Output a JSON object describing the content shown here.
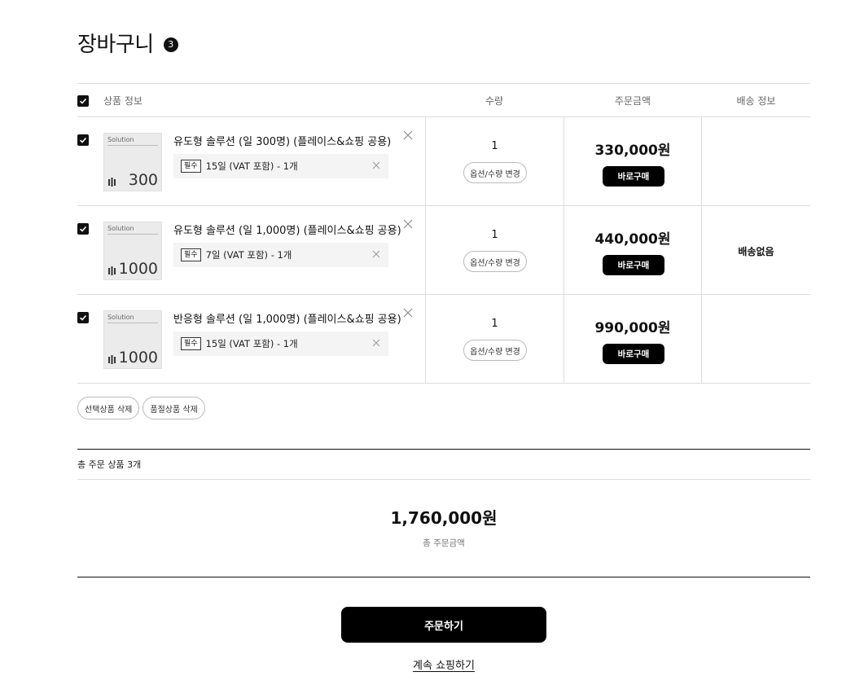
{
  "page": {
    "title": "장바구니",
    "count": "3"
  },
  "table": {
    "headers": {
      "product_info": "상품 정보",
      "quantity": "수량",
      "order_amount": "주문금액",
      "shipping": "배송 정보"
    },
    "rows": [
      {
        "thumb_label": "Solution",
        "thumb_number": "300",
        "name": "유도형 솔루션 (일 300명) (플레이스&쇼핑 공용)",
        "required_tag": "필수",
        "option": "15일 (VAT 포함) - 1개",
        "quantity": "1",
        "change_button": "옵션/수량 변경",
        "price": "330,000원",
        "buy_button": "바로구매"
      },
      {
        "thumb_label": "Solution",
        "thumb_number": "1000",
        "name": "유도형 솔루션 (일 1,000명) (플레이스&쇼핑 공용)",
        "required_tag": "필수",
        "option": "7일 (VAT 포함) - 1개",
        "quantity": "1",
        "change_button": "옵션/수량 변경",
        "price": "440,000원",
        "buy_button": "바로구매"
      },
      {
        "thumb_label": "Solution",
        "thumb_number": "1000",
        "name": "반응형 솔루션 (일 1,000명) (플레이스&쇼핑 공용)",
        "required_tag": "필수",
        "option": "15일 (VAT 포함) - 1개",
        "quantity": "1",
        "change_button": "옵션/수량 변경",
        "price": "990,000원",
        "buy_button": "바로구매"
      }
    ],
    "shipping_value": "배송없음"
  },
  "actions": {
    "delete_selected": "선택상품 삭제",
    "delete_soldout": "품절상품 삭제"
  },
  "summary": {
    "total_items": "총 주문 상품 3개",
    "total_amount": "1,760,000원",
    "total_label": "총 주문금액"
  },
  "footer": {
    "order_button": "주문하기",
    "continue_link": "계속 쇼핑하기"
  },
  "colors": {
    "accent": "#000000",
    "border": "#dddddd",
    "option_bg": "#f4f4f4"
  }
}
